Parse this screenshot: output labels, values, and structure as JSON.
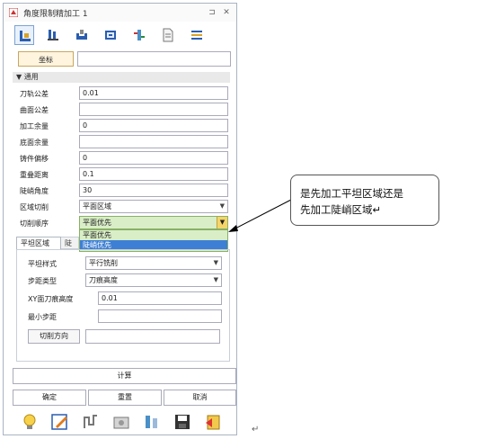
{
  "window": {
    "title": "角度限制精加工 1",
    "pin_icon": "pin-icon",
    "close_icon": "close-icon"
  },
  "toolbar": {
    "icons": [
      "tool-settings-icon",
      "mill-tool-icon",
      "workpiece-icon",
      "parameters-icon",
      "feed-icon",
      "document-icon",
      "list-icon"
    ]
  },
  "coordinate": {
    "button_label": "坐标",
    "value": ""
  },
  "section": {
    "label": "▼ 通用"
  },
  "params": [
    {
      "label": "刀轨公差",
      "value": "0.01"
    },
    {
      "label": "曲面公差",
      "value": ""
    },
    {
      "label": "加工余量",
      "value": "0"
    },
    {
      "label": "底面余量",
      "value": ""
    },
    {
      "label": "铸件偏移",
      "value": "0"
    },
    {
      "label": "重叠距离",
      "value": "0.1"
    },
    {
      "label": "陡峭角度",
      "value": "30"
    }
  ],
  "region": {
    "label": "区域切削",
    "value": "平面区域"
  },
  "order": {
    "label": "切削顺序",
    "value": "平面优先",
    "options": [
      "平面优先",
      "陡峭优先"
    ],
    "highlighted": "陡峭优先"
  },
  "tabs": {
    "active": "平坦区域",
    "inactive": "陡峭"
  },
  "flat": {
    "style_label": "平坦样式",
    "style_value": "平行铣削",
    "step_type_label": "步距类型",
    "step_type_value": "刀痕高度",
    "xy_height_label": "XY面刀痕高度",
    "xy_height_value": "0.01",
    "min_step_label": "最小步距",
    "min_step_value": "",
    "cut_dir_label": "切削方向",
    "cut_dir_value": ""
  },
  "buttons": {
    "calc": "计算",
    "ok": "确定",
    "reset": "重置",
    "cancel": "取消"
  },
  "callout": {
    "line1": "是先加工平坦区域还是",
    "line2": "先加工陡峭区域↵"
  },
  "return_mark": "↵",
  "colors": {
    "accent": "#3d7fd4",
    "dropdown_bg": "#d9eec7",
    "dropdown_button": "#f5d56a"
  }
}
